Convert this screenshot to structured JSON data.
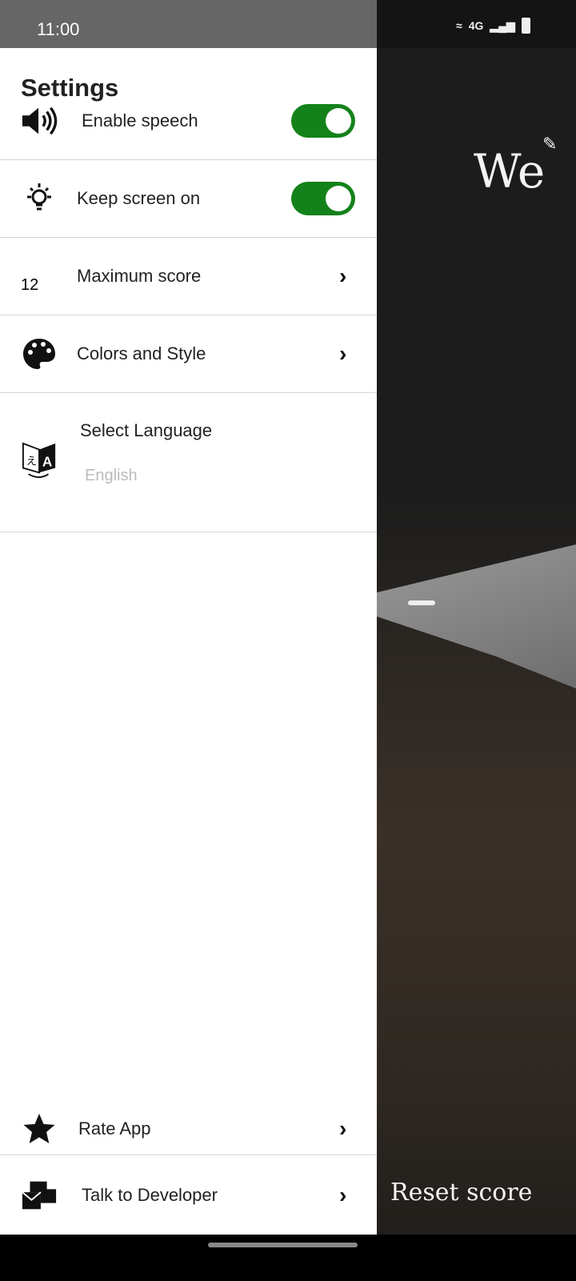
{
  "status_bar": {
    "time": "11:00",
    "network": "4G"
  },
  "drawer": {
    "title": "Settings",
    "items": [
      {
        "label": "Enable speech",
        "icon": "speaker-icon",
        "toggle": true
      },
      {
        "label": "Keep screen on",
        "icon": "lightbulb-icon",
        "toggle": true
      },
      {
        "label": "Maximum score",
        "icon": "twelve-icon",
        "icon_text": "12"
      },
      {
        "label": "Colors and Style",
        "icon": "palette-icon"
      },
      {
        "label": "Select Language",
        "icon": "translate-icon",
        "value": "English"
      }
    ],
    "bottom_items": [
      {
        "label": "Rate App",
        "icon": "star-icon"
      },
      {
        "label": "Talk to Developer",
        "icon": "mail-icon"
      }
    ]
  },
  "background": {
    "team_label": "We",
    "reset_label": "Reset score"
  },
  "colors": {
    "toggle_on": "#14821a"
  }
}
